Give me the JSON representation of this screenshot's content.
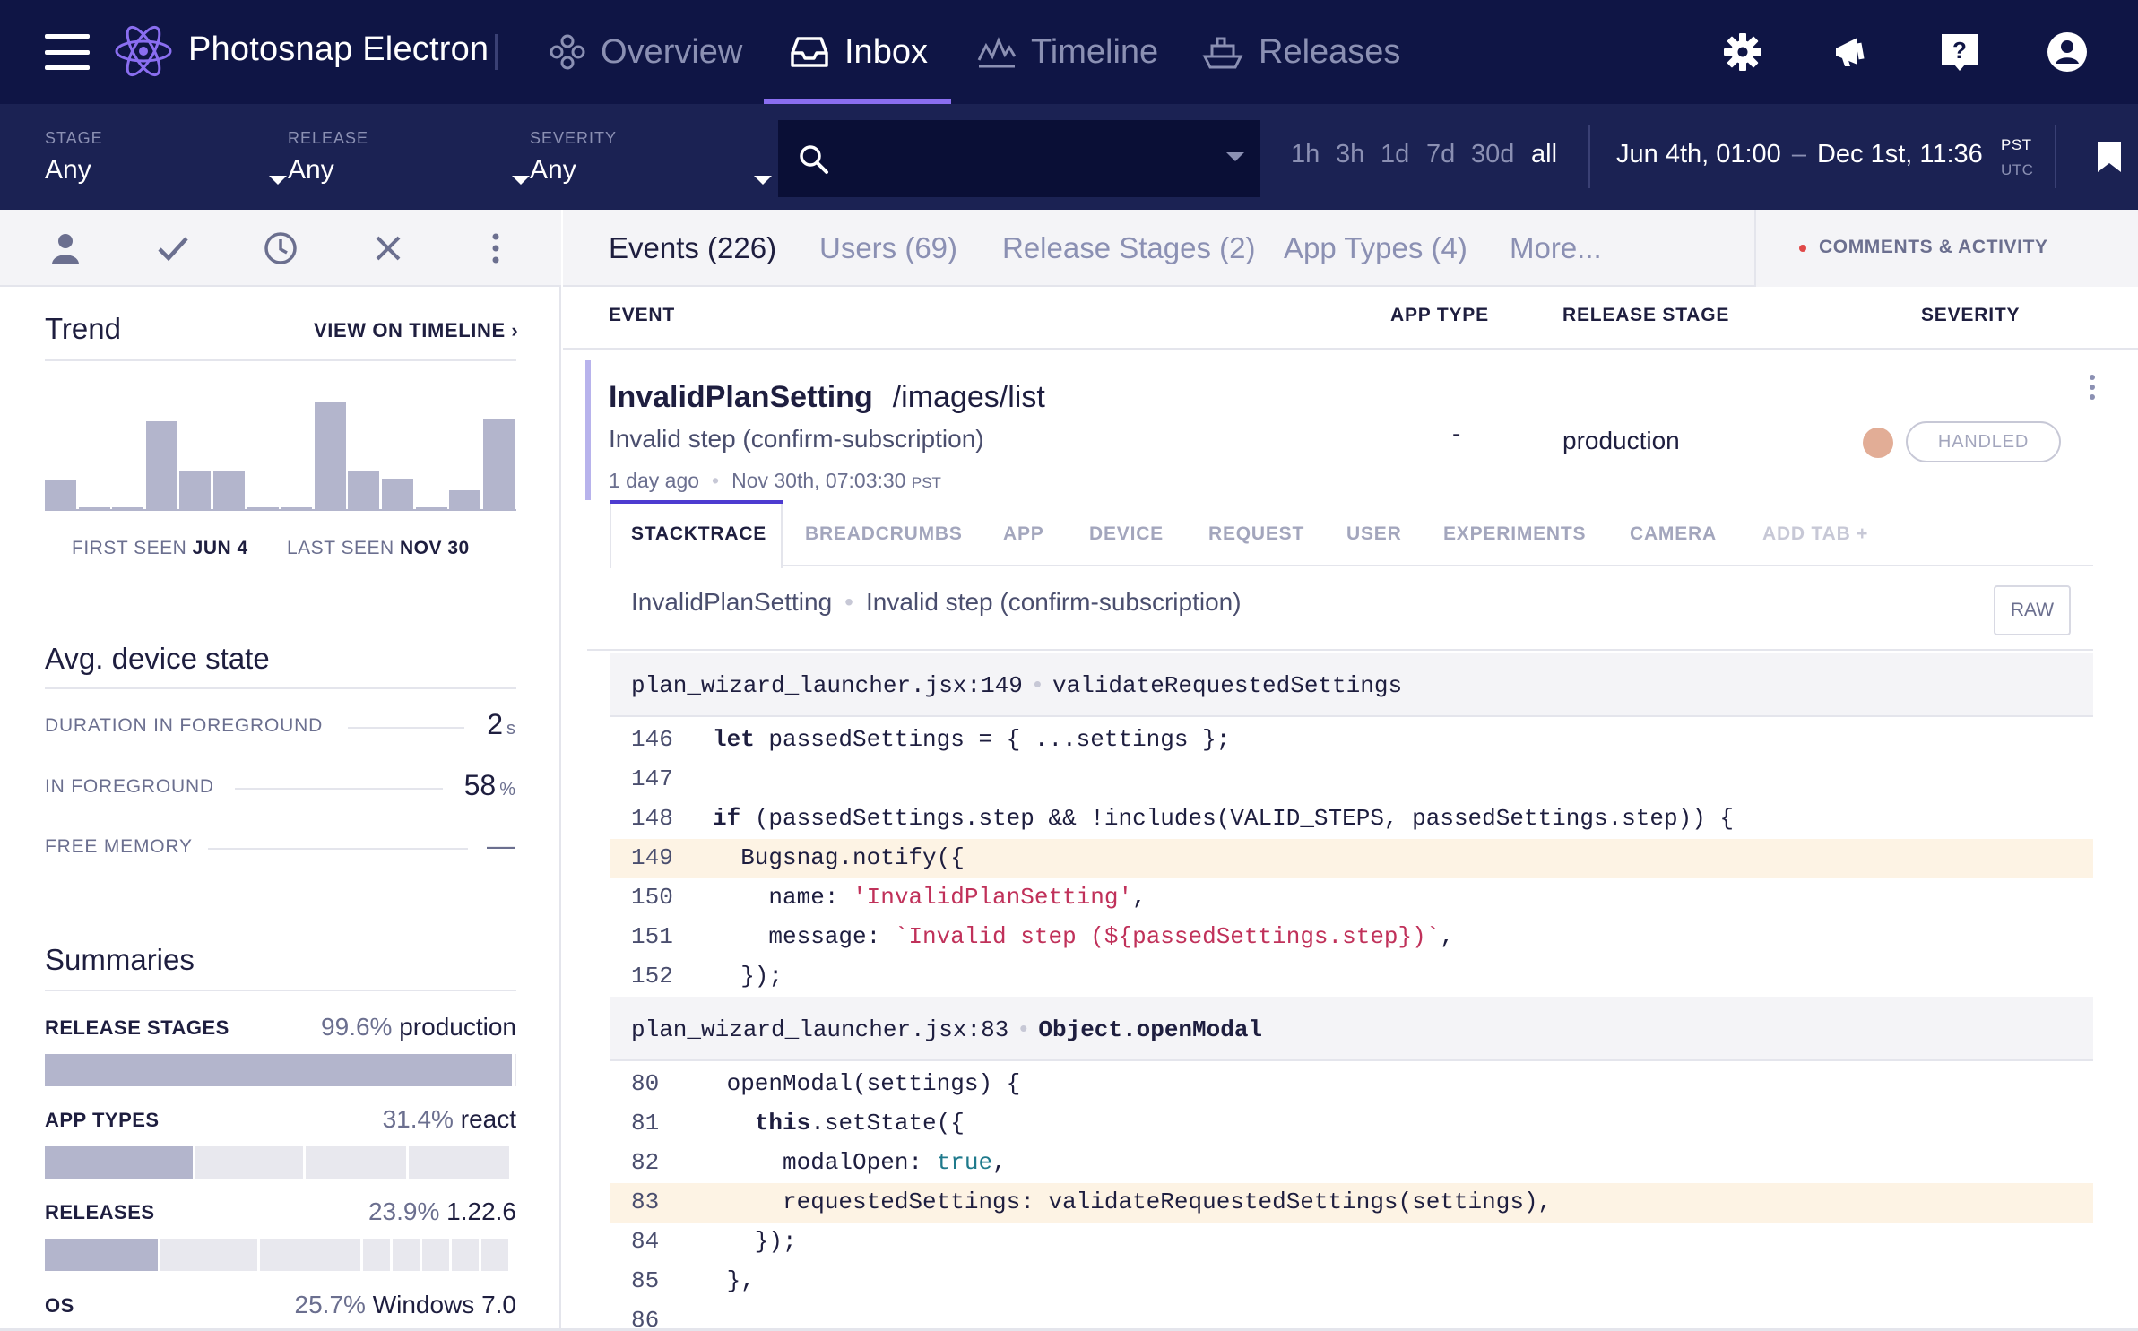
{
  "colors": {
    "nav_bg": "#0f1545",
    "filter_bg": "#1b2253",
    "accent": "#8a6ef0",
    "severity_dot": "#e2ad96",
    "highlight_line": "#fdf3e4"
  },
  "topnav": {
    "app_title": "Photosnap Electron",
    "items": [
      {
        "label": "Overview",
        "icon": "overview-icon"
      },
      {
        "label": "Inbox",
        "icon": "inbox-icon",
        "active": true
      },
      {
        "label": "Timeline",
        "icon": "timeline-icon"
      },
      {
        "label": "Releases",
        "icon": "releases-icon"
      }
    ],
    "right_icons": [
      "gear-icon",
      "megaphone-icon",
      "help-icon",
      "user-account-icon"
    ]
  },
  "filters": {
    "stage": {
      "label": "STAGE",
      "value": "Any"
    },
    "release": {
      "label": "RELEASE",
      "value": "Any"
    },
    "severity": {
      "label": "SEVERITY",
      "value": "Any"
    },
    "search": {
      "placeholder": "",
      "value": ""
    },
    "ranges": [
      "1h",
      "3h",
      "1d",
      "7d",
      "30d",
      "all"
    ],
    "selected_range": "all",
    "date_from": "Jun 4th, 01:00",
    "date_sep": "–",
    "date_to": "Dec 1st, 11:36",
    "tz_primary": "PST",
    "tz_secondary": "UTC"
  },
  "left": {
    "actions": [
      "assign-user-icon",
      "check-icon",
      "clock-icon",
      "close-icon",
      "more-vertical-icon"
    ],
    "trend": {
      "title": "Trend",
      "link": "VIEW ON TIMELINE ›",
      "bars": [
        0.33,
        0.0,
        0.0,
        0.98,
        0.43,
        0.43,
        0.0,
        0.0,
        1.2,
        0.43,
        0.34,
        0.0,
        0.21,
        1.0
      ],
      "first_seen_label": "FIRST SEEN",
      "first_seen": "JUN 4",
      "last_seen_label": "LAST SEEN",
      "last_seen": "NOV 30"
    },
    "device": {
      "title": "Avg. device state",
      "rows": [
        {
          "label": "DURATION IN FOREGROUND",
          "value": "2",
          "unit": "s"
        },
        {
          "label": "IN FOREGROUND",
          "value": "58",
          "unit": "%"
        },
        {
          "label": "FREE MEMORY",
          "value": "—",
          "unit": ""
        }
      ]
    },
    "summaries": {
      "title": "Summaries",
      "rows": [
        {
          "label": "RELEASE STAGES",
          "pct": "99.6%",
          "value": "production",
          "share": 0.996
        },
        {
          "label": "APP TYPES",
          "pct": "31.4%",
          "value": "react",
          "share": 0.314
        },
        {
          "label": "RELEASES",
          "pct": "23.9%",
          "value": "1.22.6",
          "share": 0.239
        },
        {
          "label": "OS",
          "pct": "25.7%",
          "value": "Windows 7.0",
          "share": 0.257
        }
      ]
    }
  },
  "main": {
    "tabs": [
      {
        "label": "Events (226)",
        "active": true
      },
      {
        "label": "Users (69)"
      },
      {
        "label": "Release Stages (2)"
      },
      {
        "label": "App Types (4)"
      },
      {
        "label": "More..."
      }
    ],
    "comments": "COMMENTS & ACTIVITY",
    "columns": [
      "EVENT",
      "APP TYPE",
      "RELEASE STAGE",
      "SEVERITY"
    ],
    "event": {
      "error_class": "InvalidPlanSetting",
      "context": "/images/list",
      "message": "Invalid step (confirm-subscription)",
      "age": "1 day ago",
      "timestamp": "Nov 30th, 07:03:30",
      "tz": "PST",
      "app_type": "-",
      "release_stage": "production",
      "handled": "HANDLED"
    },
    "subtabs": [
      "STACKTRACE",
      "BREADCRUMBS",
      "APP",
      "DEVICE",
      "REQUEST",
      "USER",
      "EXPERIMENTS",
      "CAMERA",
      "ADD TAB +"
    ],
    "stack_header": {
      "error_class": "InvalidPlanSetting",
      "message": "Invalid step (confirm-subscription)",
      "raw_label": "RAW"
    },
    "frames": [
      {
        "file": "plan_wizard_launcher.jsx:149",
        "method": "validateRequestedSettings",
        "lines": [
          {
            "n": "146",
            "code": "let passedSettings = { ...settings };"
          },
          {
            "n": "147",
            "code": ""
          },
          {
            "n": "148",
            "code": "if (passedSettings.step && !includes(VALID_STEPS, passedSettings.step)) {"
          },
          {
            "n": "149",
            "code": "  Bugsnag.notify({",
            "highlight": true
          },
          {
            "n": "150",
            "code": "    name: 'InvalidPlanSetting',"
          },
          {
            "n": "151",
            "code": "    message: `Invalid step (${passedSettings.step})`,"
          },
          {
            "n": "152",
            "code": "  });"
          }
        ]
      },
      {
        "file": "plan_wizard_launcher.jsx:83",
        "method": "Object.openModal",
        "lines": [
          {
            "n": "80",
            "code": " openModal(settings) {"
          },
          {
            "n": "81",
            "code": "   this.setState({"
          },
          {
            "n": "82",
            "code": "     modalOpen: true,"
          },
          {
            "n": "83",
            "code": "     requestedSettings: validateRequestedSettings(settings),",
            "highlight": true
          },
          {
            "n": "84",
            "code": "   });"
          },
          {
            "n": "85",
            "code": " },"
          },
          {
            "n": "86",
            "code": ""
          }
        ]
      }
    ]
  }
}
